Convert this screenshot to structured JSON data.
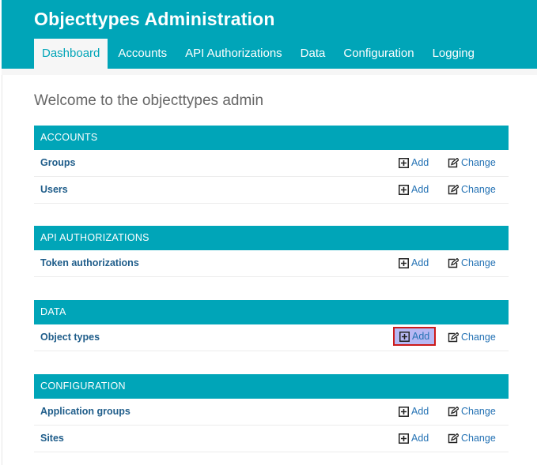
{
  "header": {
    "title": "Objecttypes Administration",
    "nav": [
      {
        "label": "Dashboard",
        "active": true
      },
      {
        "label": "Accounts",
        "active": false
      },
      {
        "label": "API Authorizations",
        "active": false
      },
      {
        "label": "Data",
        "active": false
      },
      {
        "label": "Configuration",
        "active": false
      },
      {
        "label": "Logging",
        "active": false
      }
    ]
  },
  "welcome": "Welcome to the objecttypes admin",
  "actions": {
    "add": "Add",
    "change": "Change"
  },
  "modules": {
    "accounts": {
      "title": "ACCOUNTS",
      "rows": [
        "Groups",
        "Users"
      ]
    },
    "api": {
      "title": "API AUTHORIZATIONS",
      "rows": [
        "Token authorizations"
      ]
    },
    "data": {
      "title": "DATA",
      "rows": [
        "Object types"
      ]
    },
    "config": {
      "title": "CONFIGURATION",
      "rows": [
        "Application groups",
        "Sites"
      ]
    }
  },
  "colors": {
    "header": "#00a5b8",
    "link": "#2472b4",
    "highlight_border": "#cc1a1a",
    "highlight_fill": "#b7b8f3"
  }
}
